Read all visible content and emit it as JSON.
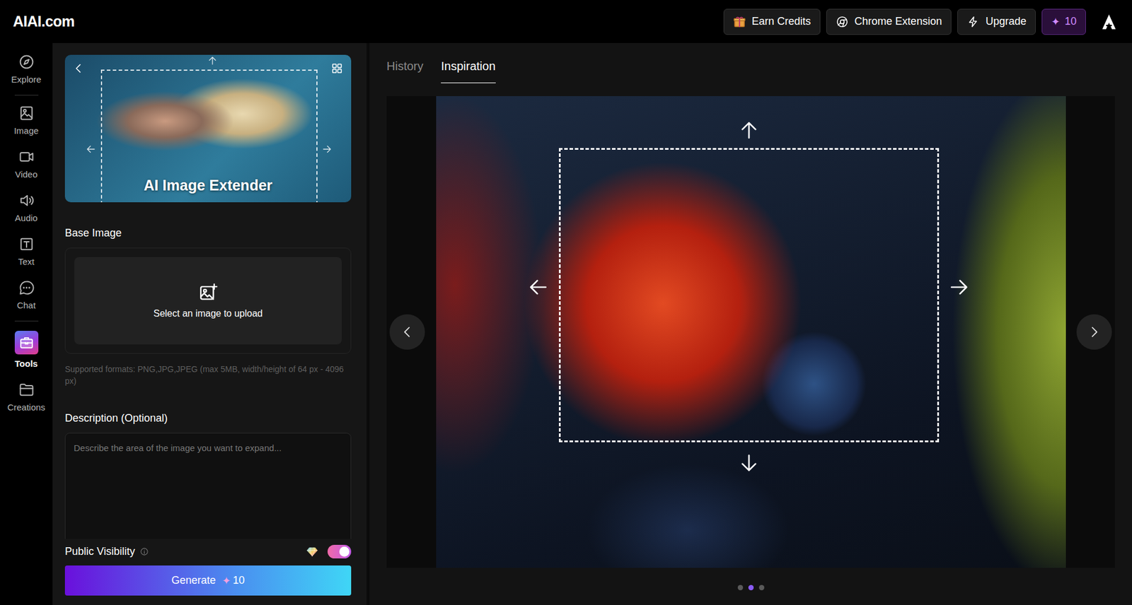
{
  "logo": "AIAI.com",
  "header_buttons": [
    {
      "label": "Earn Credits"
    },
    {
      "label": "Chrome Extension"
    },
    {
      "label": "Upgrade"
    }
  ],
  "credits": {
    "icon": "✦",
    "count": "10"
  },
  "nav": [
    {
      "label": "Explore",
      "selected": false
    },
    {
      "label": "Image",
      "selected": false
    },
    {
      "label": "Video",
      "selected": false
    },
    {
      "label": "Audio",
      "selected": false
    },
    {
      "label": "Text",
      "selected": false
    },
    {
      "label": "Chat",
      "selected": false
    },
    {
      "label": "Tools",
      "selected": true
    },
    {
      "label": "Creations",
      "selected": false
    }
  ],
  "banner": {
    "title": "AI Image Extender"
  },
  "base_image": {
    "label": "Base Image",
    "upload_text": "Select an image to upload",
    "formats": "Supported formats: PNG,JPG,JPEG (max 5MB, width/height of 64 px - 4096 px)"
  },
  "description": {
    "label": "Description (Optional)",
    "placeholder": "Describe the area of the image you want to expand..."
  },
  "visibility": {
    "label": "Public Visibility",
    "on": true
  },
  "generate": {
    "label": "Generate",
    "icon": "✦",
    "cost": "10"
  },
  "tabs": [
    {
      "label": "History",
      "selected": false
    },
    {
      "label": "Inspiration",
      "selected": true
    }
  ],
  "carousel": {
    "dots": [
      {
        "selected": false
      },
      {
        "selected": true
      },
      {
        "selected": false
      }
    ]
  }
}
